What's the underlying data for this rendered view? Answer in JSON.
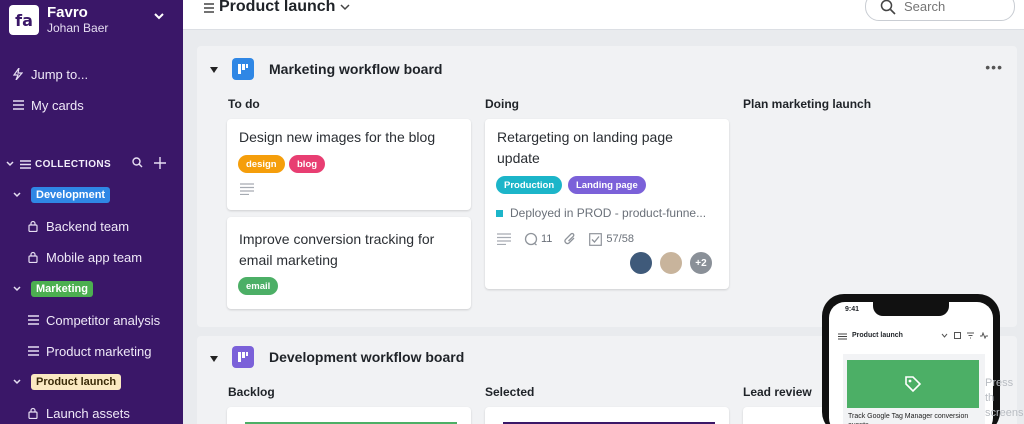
{
  "sidebar": {
    "app_name": "Favro",
    "user_name": "Johan Baer",
    "jump_label": "Jump to...",
    "my_cards_label": "My cards",
    "collections_label": "COLLECTIONS",
    "collections": [
      {
        "label": "Development",
        "items": [
          "Backend team",
          "Mobile app team"
        ]
      },
      {
        "label": "Marketing",
        "items": [
          "Competitor analysis",
          "Product marketing"
        ]
      },
      {
        "label": "Product launch",
        "items": [
          "Launch assets"
        ]
      }
    ]
  },
  "topbar": {
    "title": "Product launch",
    "search_placeholder": "Search"
  },
  "boards": [
    {
      "title": "Marketing workflow board",
      "icon_color": "#2f87e5",
      "columns": [
        {
          "title": "To do",
          "cards": [
            {
              "title": "Design new images for the blog",
              "tags": [
                {
                  "label": "design",
                  "color": "#f59e0b"
                },
                {
                  "label": "blog",
                  "color": "#e83e72"
                }
              ]
            },
            {
              "title": "Improve conversion tracking for email marketing",
              "tags": [
                {
                  "label": "email",
                  "color": "#4caf66"
                }
              ]
            }
          ]
        },
        {
          "title": "Doing",
          "cards": [
            {
              "title": "Retargeting on landing page update",
              "tags": [
                {
                  "label": "Production",
                  "color": "#1cb5c9"
                },
                {
                  "label": "Landing page",
                  "color": "#7b61d9"
                }
              ],
              "status": "Deployed in PROD - product-funne...",
              "comments": "11",
              "checklist": "57/58",
              "extra_members": "+2"
            }
          ]
        },
        {
          "title": "Plan marketing launch",
          "cards": []
        }
      ]
    },
    {
      "title": "Development workflow board",
      "icon_color": "#7b61d9",
      "columns": [
        {
          "title": "Backlog"
        },
        {
          "title": "Selected"
        },
        {
          "title": "Lead review"
        }
      ]
    }
  ],
  "phone": {
    "time": "9:41",
    "title": "Product launch",
    "card_text": "Track Google Tag Manager conversion events"
  },
  "ghost_text": "Press th screensh"
}
